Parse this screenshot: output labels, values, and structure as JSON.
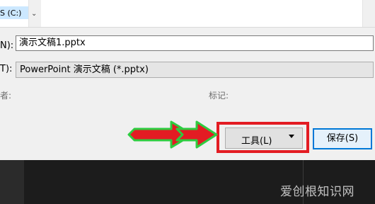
{
  "navigation": {
    "drive_label": "S (C:)"
  },
  "form": {
    "filename_label": "N):",
    "filename_value": "演示文稿1.pptx",
    "savetype_label": "T):",
    "savetype_value": "PowerPoint 演示文稿 (*.pptx)",
    "authors_label": "者:",
    "tags_label": "标记:"
  },
  "buttons": {
    "tools_label": "工具(L)",
    "save_label": "保存(S)"
  },
  "annotation": {
    "arrow_fill": "#e31c23",
    "arrow_outline": "#2ecc40",
    "highlight_color": "#e31c23"
  },
  "watermark": {
    "text": "爱创根知识网"
  }
}
